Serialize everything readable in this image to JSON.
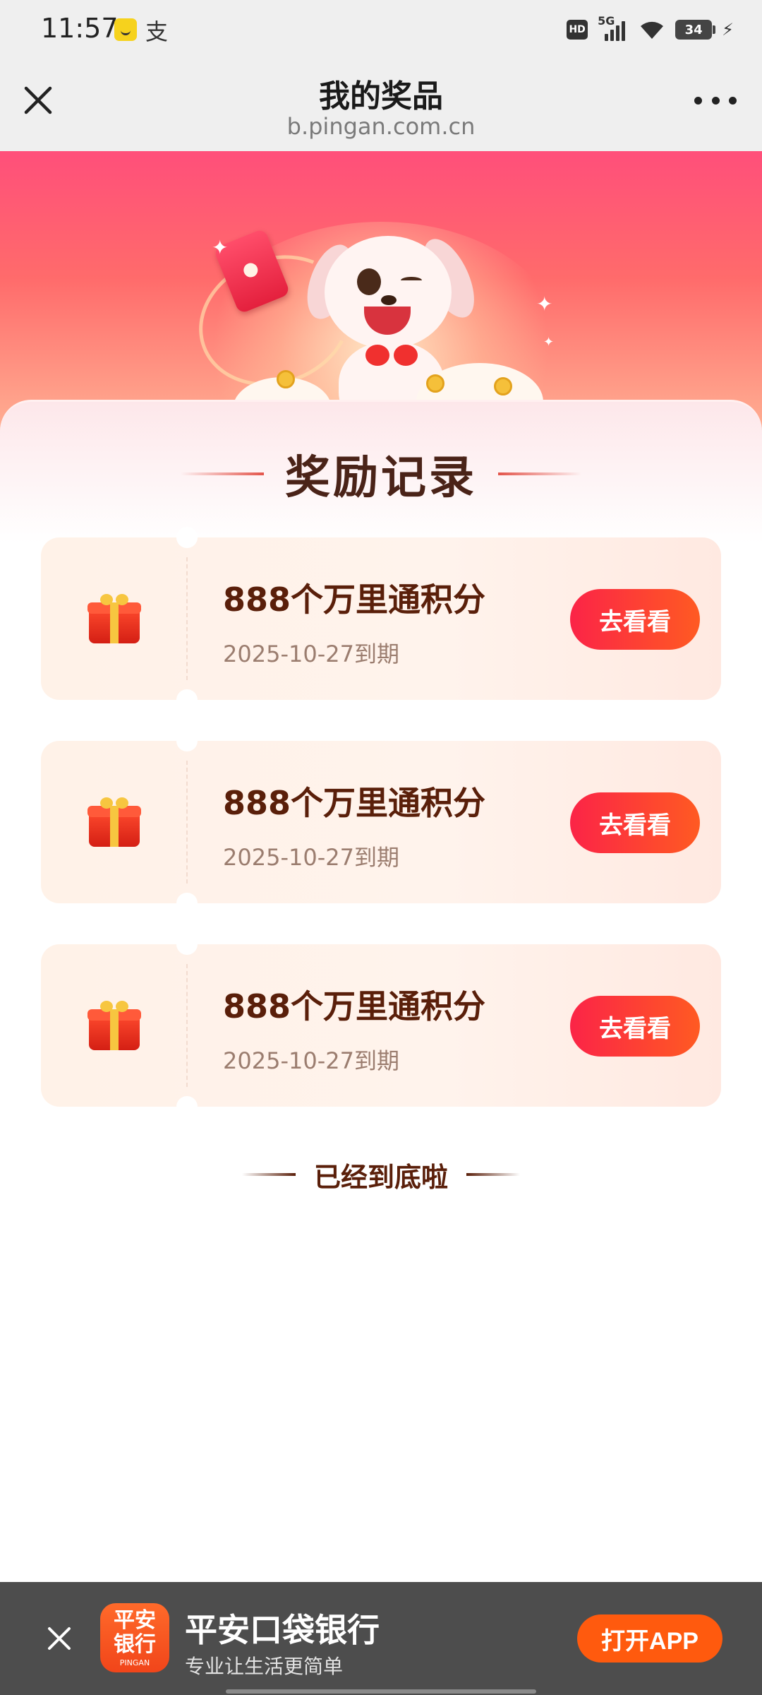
{
  "status_bar": {
    "time": "11:57",
    "network": "5G",
    "hd": "HD",
    "battery": "34"
  },
  "header": {
    "title": "我的奖品",
    "url": "b.pingan.com.cn"
  },
  "section": {
    "title": "奖励记录"
  },
  "prizes": [
    {
      "name": "888个万里通积分",
      "expiry": "2025-10-27到期",
      "button": "去看看"
    },
    {
      "name": "888个万里通积分",
      "expiry": "2025-10-27到期",
      "button": "去看看"
    },
    {
      "name": "888个万里通积分",
      "expiry": "2025-10-27到期",
      "button": "去看看"
    }
  ],
  "end_text": "已经到底啦",
  "app_banner": {
    "logo_line1": "平安",
    "logo_line2": "银行",
    "logo_sub": "PINGAN",
    "name": "平安口袋银行",
    "slogan": "专业让生活更简单",
    "button": "打开APP"
  },
  "colors": {
    "accent": "#fb2447",
    "brand_orange": "#ff5a0e",
    "title_brown": "#5a1f0a"
  }
}
